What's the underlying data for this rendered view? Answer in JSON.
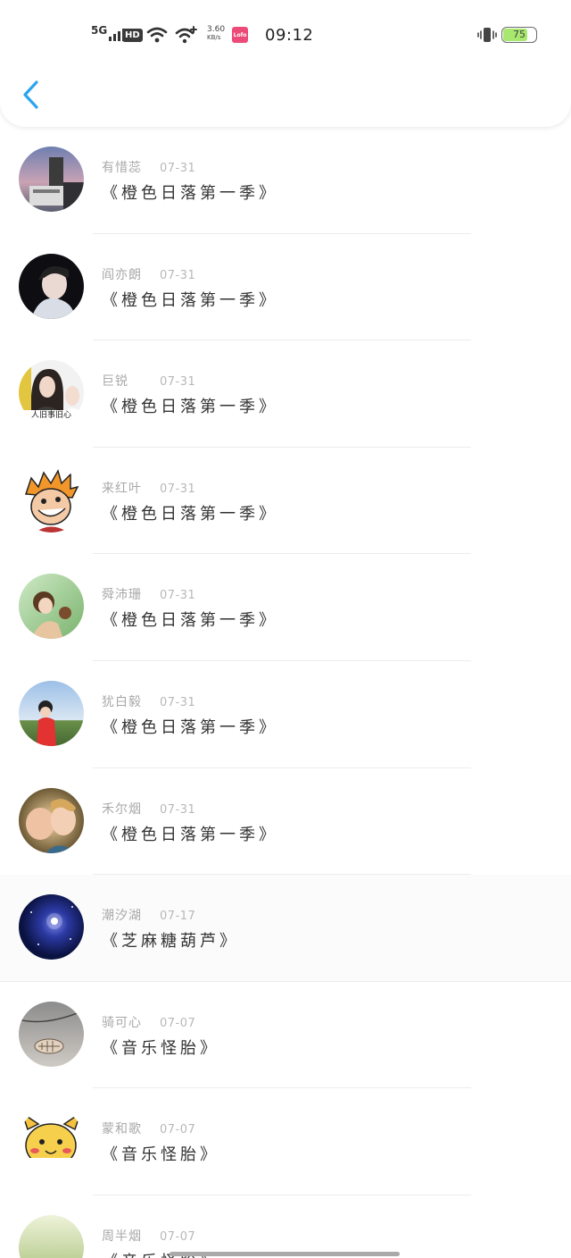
{
  "status_bar": {
    "network": "5G",
    "hd": "HD",
    "speed_value": "3.60",
    "speed_unit": "KB/s",
    "app_badge": "Lofo",
    "time": "09:12",
    "battery": "75",
    "battery_level": 0.75
  },
  "header": {
    "back_icon": "chevron-left-icon",
    "accent_color": "#2aa5ee"
  },
  "items": [
    {
      "name": "有惜蕊",
      "date": "07-31",
      "title": "《橙色日落第一季》",
      "avatar_caption": ""
    },
    {
      "name": "阎亦朗",
      "date": "07-31",
      "title": "《橙色日落第一季》",
      "avatar_caption": ""
    },
    {
      "name": "巨锐",
      "date": "07-31",
      "title": "《橙色日落第一季》",
      "avatar_caption": "人旧事旧心"
    },
    {
      "name": "来红叶",
      "date": "07-31",
      "title": "《橙色日落第一季》",
      "avatar_caption": ""
    },
    {
      "name": "舜沛珊",
      "date": "07-31",
      "title": "《橙色日落第一季》",
      "avatar_caption": ""
    },
    {
      "name": "犹白毅",
      "date": "07-31",
      "title": "《橙色日落第一季》",
      "avatar_caption": ""
    },
    {
      "name": "禾尔烟",
      "date": "07-31",
      "title": "《橙色日落第一季》",
      "avatar_caption": ""
    },
    {
      "name": "潮汐湖",
      "date": "07-17",
      "title": "《芝麻糖葫芦》",
      "avatar_caption": ""
    },
    {
      "name": "骑可心",
      "date": "07-07",
      "title": "《音乐怪胎》",
      "avatar_caption": ""
    },
    {
      "name": "蒙和歌",
      "date": "07-07",
      "title": "《音乐怪胎》",
      "avatar_caption": ""
    },
    {
      "name": "周半烟",
      "date": "07-07",
      "title": "《音乐怪胎》",
      "avatar_caption": ""
    }
  ]
}
